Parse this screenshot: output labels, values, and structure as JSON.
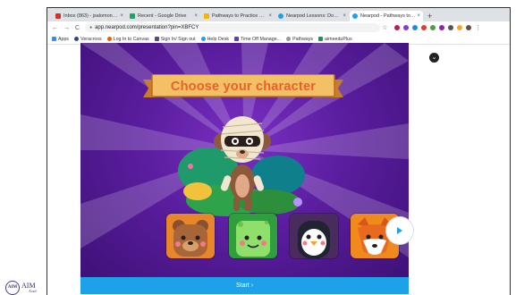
{
  "browser": {
    "tabs": [
      {
        "label": "Inbox (863) - jsalomone@iam-...",
        "favicon_color": "#d93025",
        "active": false
      },
      {
        "label": "Recent - Google Drive",
        "favicon_color": "#1fa463",
        "active": false
      },
      {
        "label": "Pathways to Practice Webinar",
        "favicon_color": "#f4b400",
        "active": false
      },
      {
        "label": "Nearpod Lessons: Download ...",
        "favicon_color": "#1da1e8",
        "active": false
      },
      {
        "label": "Nearpod - Pathways to Practice",
        "favicon_color": "#1da1e8",
        "active": true
      }
    ],
    "new_tab_glyph": "+",
    "close_glyph": "×",
    "url": "app.nearpod.com/presentation?pin=XBFCY",
    "nav": {
      "back": "←",
      "forward": "→",
      "reload": "C"
    },
    "bookmarks": [
      {
        "label": "Apps",
        "color": "#4285f4"
      },
      {
        "label": "Veracross",
        "color": "#2b4a8c"
      },
      {
        "label": "Log In to Canvas",
        "color": "#e66000"
      },
      {
        "label": "Sign In/ Sign out",
        "color": "#5b3fb5"
      },
      {
        "label": "Help Desk",
        "color": "#1da1e8"
      },
      {
        "label": "Time Off Manage...",
        "color": "#5b3fb5"
      },
      {
        "label": "Pathways",
        "color": "#999999"
      },
      {
        "label": "aimeeduPlus",
        "color": "#2e8b57"
      }
    ]
  },
  "slide": {
    "title": "Choose your character",
    "start_label": "Start ›",
    "characters": [
      {
        "name": "bear",
        "bg": "#e8862a"
      },
      {
        "name": "alien",
        "bg": "#2f9e3c"
      },
      {
        "name": "penguin",
        "bg": "#4a2b5e"
      },
      {
        "name": "fox",
        "bg": "#f08a1c"
      }
    ]
  },
  "logo": {
    "initials": "AIM",
    "text": "AIM",
    "sub": "Acad"
  }
}
